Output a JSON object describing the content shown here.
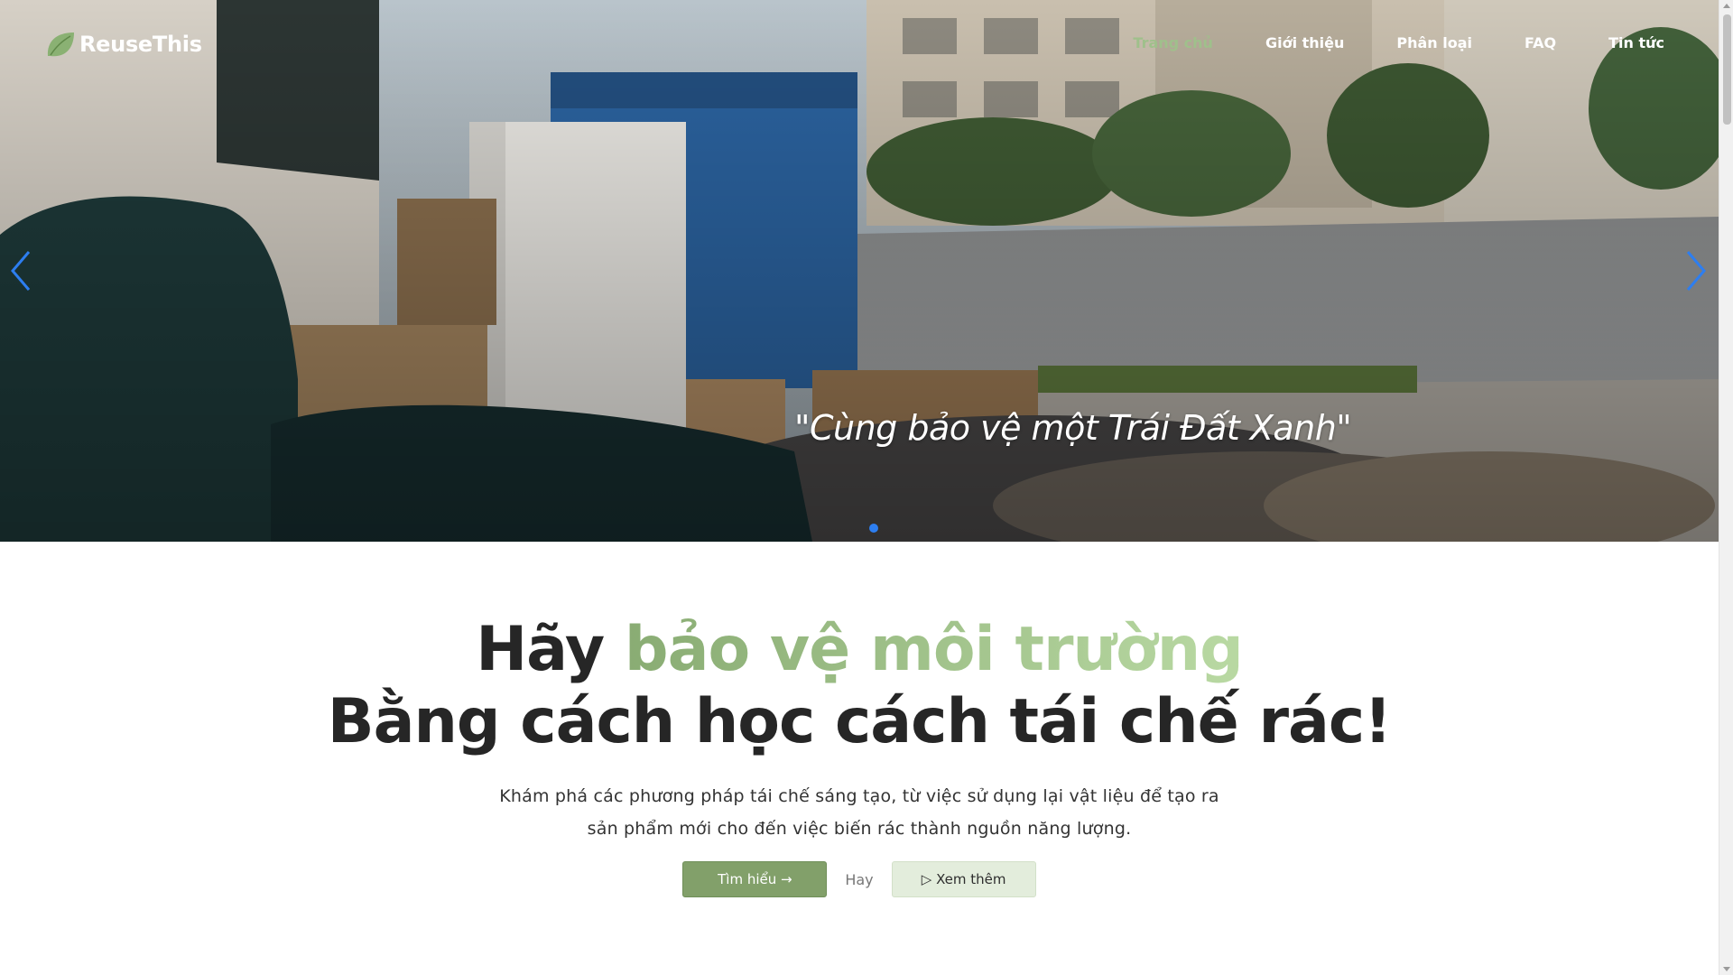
{
  "brand": {
    "name": "ReuseThis",
    "icon": "leaf-icon",
    "color": "#8ab173"
  },
  "nav": {
    "items": [
      {
        "label": "Trang chủ",
        "active": true
      },
      {
        "label": "Giới thiệu",
        "active": false
      },
      {
        "label": "Phân loại",
        "active": false
      },
      {
        "label": "FAQ",
        "active": false
      },
      {
        "label": "Tin tức",
        "active": false
      }
    ],
    "active_color": "#9fc08b"
  },
  "hero": {
    "caption": "\"Cùng bảo vệ một Trái Đất Xanh\"",
    "prev_icon": "chevron-left-icon",
    "next_icon": "chevron-right-icon",
    "arrow_color": "#2d7ef0",
    "slide_count_visible": 1
  },
  "main": {
    "headline_prefix": "Hãy ",
    "headline_accent": "bảo vệ môi trường",
    "headline_line2": "Bằng cách học cách tái chế rác!",
    "description": "Khám phá các phương pháp tái chế sáng tạo, từ việc sử dụng lại vật liệu để tạo ra sản phẩm mới cho đến việc biến rác thành nguồn năng lượng.",
    "primary_button": "Tìm hiểu →",
    "or_text": "Hay",
    "secondary_button": "▷ Xem thêm",
    "accent_gradient": [
      "#89ac73",
      "#b9d9a3"
    ]
  }
}
